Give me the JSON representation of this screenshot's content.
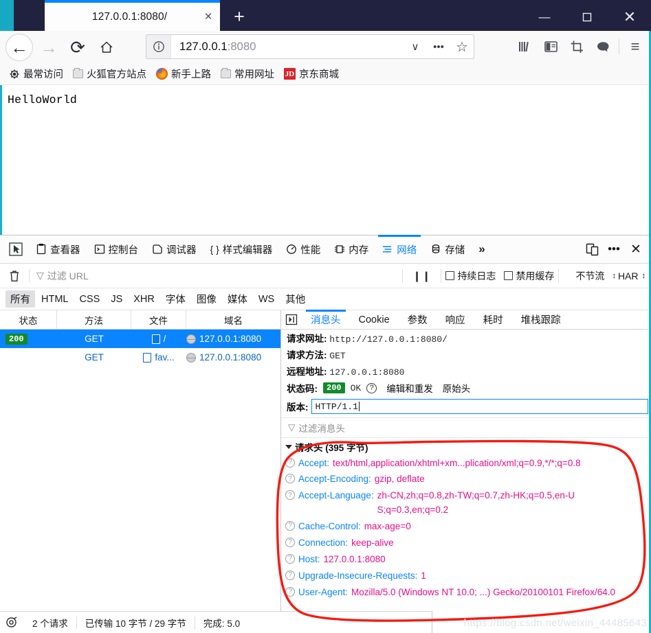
{
  "window": {
    "tab_title": "127.0.0.1:8080/",
    "close_tab_glyph": "×",
    "new_tab_glyph": "+",
    "minimize_glyph": "—",
    "close_glyph": "✕"
  },
  "navbar": {
    "back_glyph": "←",
    "forward_glyph": "→",
    "reload_glyph": "⟳",
    "home_glyph": "⌂",
    "url_host": "127.0.0.1",
    "url_port": ":8080",
    "identity_icon": "info-circle-icon",
    "dropdown_glyph": "∨",
    "more_glyph": "•••",
    "star_glyph": "☆",
    "menu_glyph": "≡"
  },
  "bookmarks": [
    {
      "label": "最常访问",
      "icon": "gear-icon"
    },
    {
      "label": "火狐官方站点",
      "icon": "folder-icon"
    },
    {
      "label": "新手上路",
      "icon": "firefox-icon"
    },
    {
      "label": "常用网址",
      "icon": "folder-icon"
    },
    {
      "label": "京东商城",
      "icon": "jd-icon",
      "badge": "JD"
    }
  ],
  "page": {
    "body_text": "HelloWorld"
  },
  "devtools": {
    "tabs": [
      {
        "label": "查看器",
        "icon": "inspector-icon",
        "active": false
      },
      {
        "label": "控制台",
        "icon": "console-icon",
        "active": false
      },
      {
        "label": "调试器",
        "icon": "debugger-icon",
        "active": false
      },
      {
        "label": "样式编辑器",
        "icon": "style-editor-icon",
        "active": false
      },
      {
        "label": "性能",
        "icon": "performance-icon",
        "active": false
      },
      {
        "label": "内存",
        "icon": "memory-icon",
        "active": false
      },
      {
        "label": "网络",
        "icon": "network-icon",
        "active": true
      },
      {
        "label": "存储",
        "icon": "storage-icon",
        "active": false
      }
    ],
    "overflow_glyph": "»",
    "responsive_icon": "responsive-design-icon",
    "meatball_glyph": "•••",
    "close_glyph": "✕",
    "filterbar": {
      "trash_icon": "trash-icon",
      "filter_placeholder": "过滤 URL",
      "funnel_glyph": "▽",
      "pause_glyph": "❙❙",
      "persist_logs": "持续日志",
      "disable_cache": "禁用缓存",
      "throttle": "不节流",
      "har": "HAR",
      "spinner_glyph": "↕"
    },
    "type_filters": [
      {
        "label": "所有",
        "active": true
      },
      {
        "label": "HTML",
        "active": false
      },
      {
        "label": "CSS",
        "active": false
      },
      {
        "label": "JS",
        "active": false
      },
      {
        "label": "XHR",
        "active": false
      },
      {
        "label": "字体",
        "active": false
      },
      {
        "label": "图像",
        "active": false
      },
      {
        "label": "媒体",
        "active": false
      },
      {
        "label": "WS",
        "active": false
      },
      {
        "label": "其他",
        "active": false
      }
    ],
    "request_table": {
      "columns": [
        "状态",
        "方法",
        "文件",
        "域名"
      ],
      "rows": [
        {
          "status": "200",
          "method": "GET",
          "file": "/",
          "domain": "127.0.0.1:8080",
          "selected": true
        },
        {
          "status": "",
          "method": "GET",
          "file": "fav...",
          "domain": "127.0.0.1:8080",
          "selected": false
        }
      ]
    },
    "detail": {
      "expand_icon": "expand-panel-icon",
      "tabs": [
        {
          "label": "消息头",
          "active": true
        },
        {
          "label": "Cookie",
          "active": false
        },
        {
          "label": "参数",
          "active": false
        },
        {
          "label": "响应",
          "active": false
        },
        {
          "label": "耗时",
          "active": false
        },
        {
          "label": "堆栈跟踪",
          "active": false
        }
      ],
      "request_url_label": "请求网址:",
      "request_url_value": "http://127.0.0.1:8080/",
      "request_method_label": "请求方法:",
      "request_method_value": "GET",
      "remote_addr_label": "远程地址:",
      "remote_addr_value": "127.0.0.1:8080",
      "status_label": "状态码:",
      "status_code": "200",
      "status_text": "OK",
      "help_glyph": "?",
      "edit_resend": "编辑和重发",
      "raw_headers": "原始头",
      "version_label": "版本:",
      "version_value": "HTTP/1.1",
      "header_filter_placeholder": "过滤消息头",
      "funnel_glyph": "▽",
      "section_title": "请求头 (395 字节)",
      "headers": [
        {
          "name": "Accept:",
          "value": "text/html,application/xhtml+xm...plication/xml;q=0.9,*/*;q=0.8"
        },
        {
          "name": "Accept-Encoding:",
          "value": "gzip, deflate"
        },
        {
          "name": "Accept-Language:",
          "value": "zh-CN,zh;q=0.8,zh-TW;q=0.7,zh-HK;q=0.5,en-US;q=0.3,en;q=0.2"
        },
        {
          "name": "Cache-Control:",
          "value": "max-age=0"
        },
        {
          "name": "Connection:",
          "value": "keep-alive"
        },
        {
          "name": "Host:",
          "value": "127.0.0.1:8080"
        },
        {
          "name": "Upgrade-Insecure-Requests:",
          "value": "1"
        },
        {
          "name": "User-Agent:",
          "value": "Mozilla/5.0 (Windows NT 10.0; ...) Gecko/20100101 Firefox/64.0"
        }
      ]
    },
    "status_bar": {
      "icon": "network-summary-icon",
      "requests": "2 个请求",
      "transferred": "已传输 10 字节 / 29 字节",
      "finish": "完成: 5.0"
    }
  },
  "annotation": {
    "shape": "red-ellipse",
    "color": "#f41b12"
  },
  "watermark": {
    "text": "https://blog.csdn.net/weixin_44485643"
  },
  "colors": {
    "titlebar": "#20223f",
    "accent_teal": "#19b1cc",
    "tab_accent_blue": "#0a84ff",
    "status_green": "#128a2c",
    "header_name": "#0a84ff",
    "header_value": "#ed0c8c"
  }
}
